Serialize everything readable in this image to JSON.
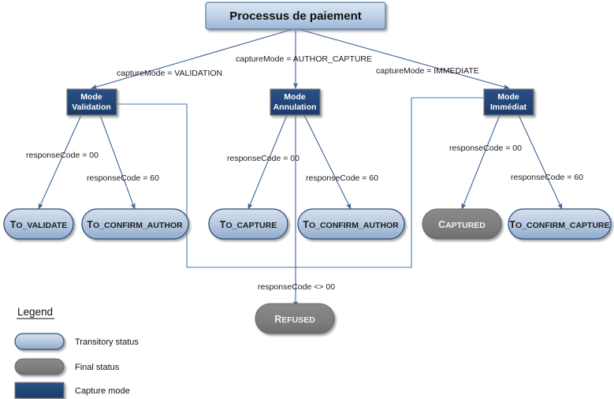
{
  "diagram": {
    "title_box": {
      "label": "Processus de paiement"
    },
    "capture_modes": [
      {
        "id": "validation",
        "line1": "Mode",
        "line2": "Validation",
        "edge_label": "captureMode = VALIDATION"
      },
      {
        "id": "annulation",
        "line1": "Mode",
        "line2": "Annulation",
        "edge_label": "captureMode = AUTHOR_CAPTURE"
      },
      {
        "id": "immediat",
        "line1": "Mode",
        "line2": "Immédiat",
        "edge_label": "captureMode = IMMEDIATE"
      }
    ],
    "response_labels": {
      "ok": "responseCode = 00",
      "sixty": "responseCode = 60",
      "not_ok": "responseCode <> 00"
    },
    "statuses": [
      {
        "id": "to_validate",
        "first": "T",
        "rest": "O_VALIDATE",
        "kind": "transitory"
      },
      {
        "id": "to_confirm_author1",
        "first": "T",
        "rest": "O_CONFIRM_AUTHOR",
        "kind": "transitory"
      },
      {
        "id": "to_capture",
        "first": "T",
        "rest": "O_CAPTURE",
        "kind": "transitory"
      },
      {
        "id": "to_confirm_author2",
        "first": "T",
        "rest": "O_CONFIRM_AUTHOR",
        "kind": "transitory"
      },
      {
        "id": "captured",
        "first": "C",
        "rest": "APTURED",
        "kind": "final"
      },
      {
        "id": "to_confirm_capture",
        "first": "T",
        "rest": "O_CONFIRM_CAPTURE",
        "kind": "transitory"
      },
      {
        "id": "refused",
        "first": "R",
        "rest": "EFUSED",
        "kind": "final"
      }
    ],
    "legend": {
      "title": "Legend",
      "items": [
        {
          "id": "transitory",
          "label": "Transitory status",
          "shape": "rounded",
          "color": "#adc3de"
        },
        {
          "id": "final",
          "label": "Final status",
          "shape": "rounded",
          "color": "#7f7f7f"
        },
        {
          "id": "capture",
          "label": "Capture mode",
          "shape": "rect",
          "color": "#1f4070"
        }
      ]
    },
    "colors": {
      "title_fill_top": "#d6e2f0",
      "title_fill_bottom": "#9fb8d8",
      "mode_fill": "#1f4070",
      "transitory_top": "#cdd9ea",
      "transitory_bottom": "#93aecd",
      "final_fill": "#7f7f7f",
      "connector": "#3f6296",
      "bracket": "#4a76ad",
      "border": "#2f4f7a"
    }
  }
}
